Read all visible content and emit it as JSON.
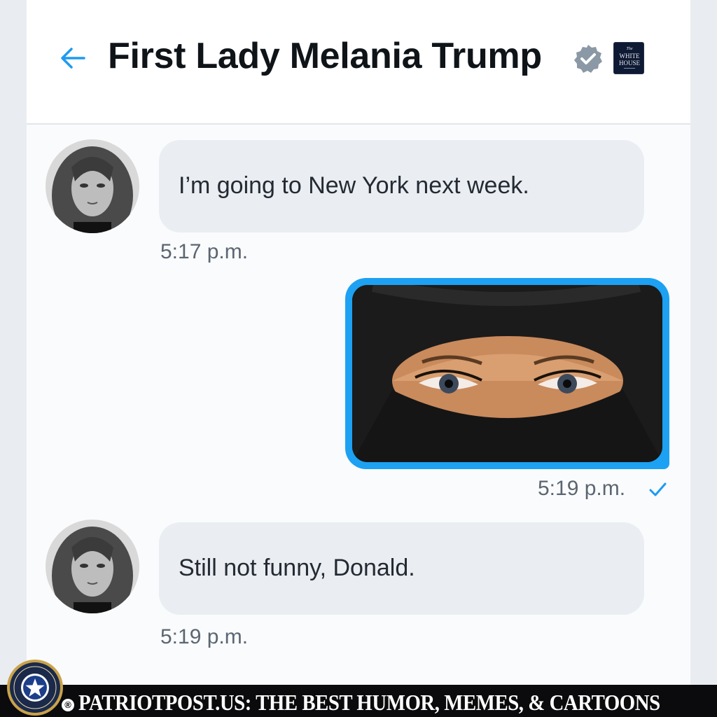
{
  "header": {
    "title": "First Lady Melania Trump",
    "badge_line1": "The",
    "badge_line2": "WHITE",
    "badge_line3": "HOUSE"
  },
  "messages": [
    {
      "sender": "contact",
      "text": "I’m going to New York next week.",
      "time": "5:17 p.m."
    },
    {
      "sender": "me",
      "type": "image",
      "time": "5:19 p.m.",
      "status": "sent"
    },
    {
      "sender": "contact",
      "text": "Still not funny, Donald.",
      "time": "5:19 p.m."
    }
  ],
  "banner": {
    "text": "PATRIOTPOST.US: THE BEST HUMOR, MEMES, & CARTOONS",
    "registered": "®"
  },
  "colors": {
    "accent": "#1da1f2",
    "bubble": "#eaedf1",
    "banner_bg": "#0b0b0d",
    "verified": "#8b98a5"
  },
  "icons": [
    "back-arrow-icon",
    "verified-badge-icon",
    "white-house-badge-icon",
    "read-check-icon",
    "patriot-post-seal-icon"
  ]
}
